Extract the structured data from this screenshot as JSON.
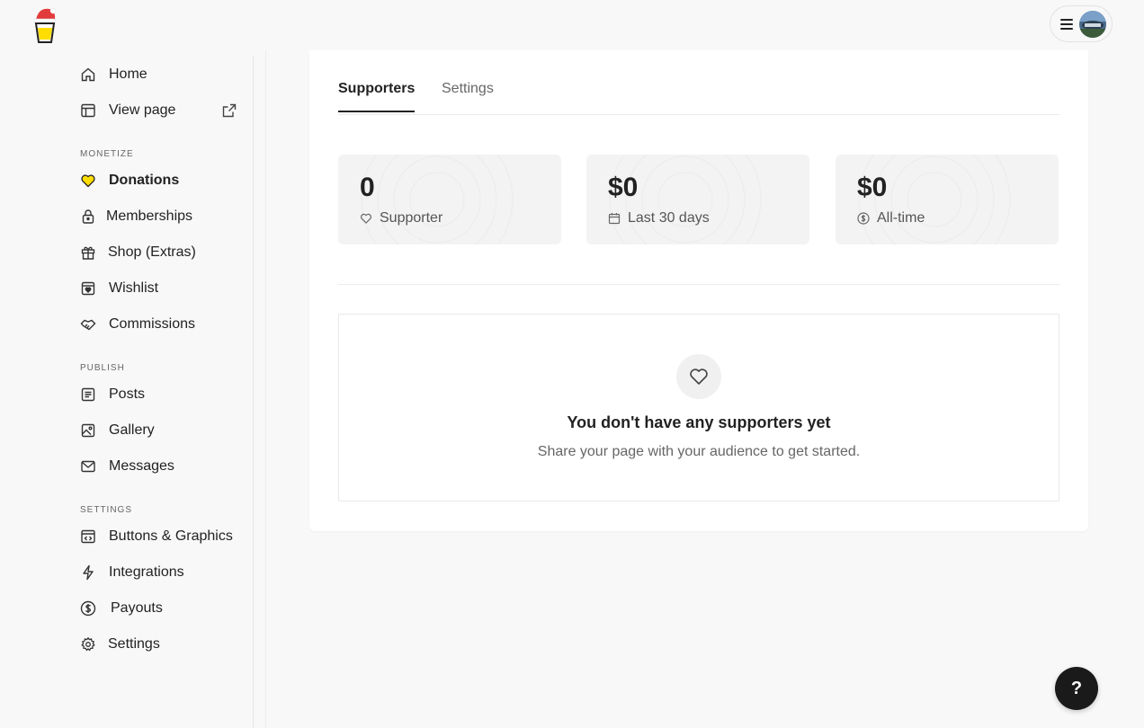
{
  "sidebar": {
    "home": "Home",
    "view_page": "View page",
    "sections": {
      "monetize": "Monetize",
      "publish": "Publish",
      "settings": "Settings"
    },
    "monetize_items": {
      "donations": "Donations",
      "memberships": "Memberships",
      "shop": "Shop (Extras)",
      "wishlist": "Wishlist",
      "commissions": "Commissions"
    },
    "publish_items": {
      "posts": "Posts",
      "gallery": "Gallery",
      "messages": "Messages"
    },
    "settings_items": {
      "buttons": "Buttons & Graphics",
      "integrations": "Integrations",
      "payouts": "Payouts",
      "settings": "Settings"
    }
  },
  "tabs": {
    "supporters": "Supporters",
    "settings": "Settings"
  },
  "stats": [
    {
      "value": "0",
      "label": "Supporter",
      "icon": "heart-icon"
    },
    {
      "value": "$0",
      "label": "Last 30 days",
      "icon": "calendar-icon"
    },
    {
      "value": "$0",
      "label": "All-time",
      "icon": "dollar-icon"
    }
  ],
  "empty_state": {
    "title": "You don't have any supporters yet",
    "subtitle": "Share your page with your audience to get started."
  },
  "help_label": "?",
  "colors": {
    "accent_yellow": "#FFDD00",
    "background": "#f8f8f8",
    "card": "#ffffff",
    "text": "#222222"
  }
}
